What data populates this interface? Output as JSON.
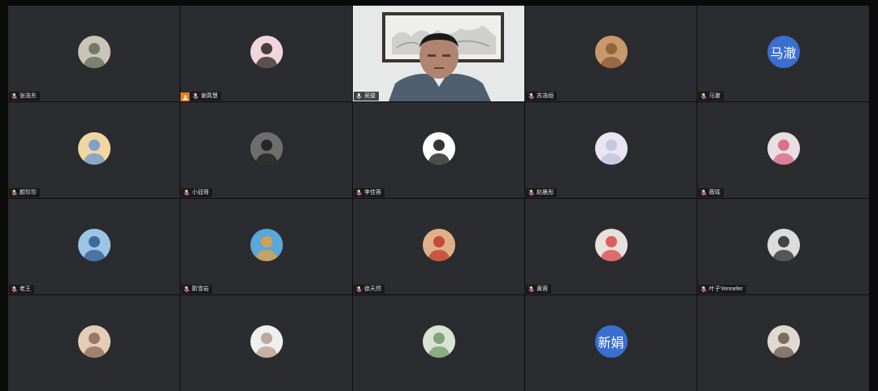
{
  "participants": [
    {
      "name": "张浩东",
      "mic": "muted",
      "avatar_colors": [
        "#c9c4b8",
        "#5f6b5a"
      ]
    },
    {
      "name": "谢真慧",
      "mic": "muted",
      "sharing": true,
      "avatar_colors": [
        "#f3d6dc",
        "#2a2326"
      ]
    },
    {
      "name": "吴骏",
      "mic": "on",
      "video": true
    },
    {
      "name": "苏浩烜",
      "mic": "muted",
      "avatar_colors": [
        "#c8996b",
        "#8a5a36"
      ]
    },
    {
      "name": "马澈",
      "mic": "muted",
      "avatar_text": "马澈"
    },
    {
      "name": "颜珍珍",
      "mic": "muted",
      "avatar_colors": [
        "#f1d6a0",
        "#6c95d2"
      ]
    },
    {
      "name": "小冠哥",
      "mic": "muted",
      "avatar_colors": [
        "#6e6e6e",
        "#1b1b1b"
      ]
    },
    {
      "name": "李佳蓉",
      "mic": "muted",
      "avatar_colors": [
        "#ffffff",
        "#111111"
      ]
    },
    {
      "name": "赵晨彤",
      "mic": "muted",
      "avatar_colors": [
        "#e9e6f2",
        "#bfc2dc"
      ]
    },
    {
      "name": "薇瑶",
      "mic": "muted",
      "avatar_colors": [
        "#e9dfe2",
        "#d6607e"
      ]
    },
    {
      "name": "老王",
      "mic": "muted",
      "avatar_colors": [
        "#9cc4e6",
        "#2d5a8c"
      ]
    },
    {
      "name": "靳雪岩",
      "mic": "muted",
      "avatar_colors": [
        "#5aa7d9",
        "#e4a040"
      ]
    },
    {
      "name": "徐天然",
      "mic": "muted",
      "avatar_colors": [
        "#e0b08a",
        "#c0392b"
      ]
    },
    {
      "name": "黄蓉",
      "mic": "muted",
      "avatar_colors": [
        "#e8e0dc",
        "#d94646"
      ]
    },
    {
      "name": "叶子Yennefer",
      "mic": "muted",
      "avatar_colors": [
        "#dcdcdc",
        "#2a2a2a"
      ]
    },
    {
      "name": "",
      "mic": "muted",
      "avatar_colors": [
        "#e5ccb6",
        "#8a6a56"
      ]
    },
    {
      "name": "",
      "mic": "muted",
      "avatar_colors": [
        "#efefef",
        "#b59b8c"
      ]
    },
    {
      "name": "",
      "mic": "muted",
      "avatar_colors": [
        "#d8e3d2",
        "#6f9a65"
      ]
    },
    {
      "name": "",
      "mic": "muted",
      "avatar_text": "新娟"
    },
    {
      "name": "",
      "mic": "muted",
      "avatar_colors": [
        "#e1d8cf",
        "#6a5a4d"
      ]
    }
  ],
  "colors": {
    "tile_bg": "#2b2c2f",
    "active_border": "#38c46a",
    "text_avatar_bg": "#3a6fd0",
    "share_badge": "#ef7b1a"
  },
  "icons": {
    "muted": "mic-muted-icon",
    "on": "mic-icon",
    "share": "screen-share-icon"
  }
}
